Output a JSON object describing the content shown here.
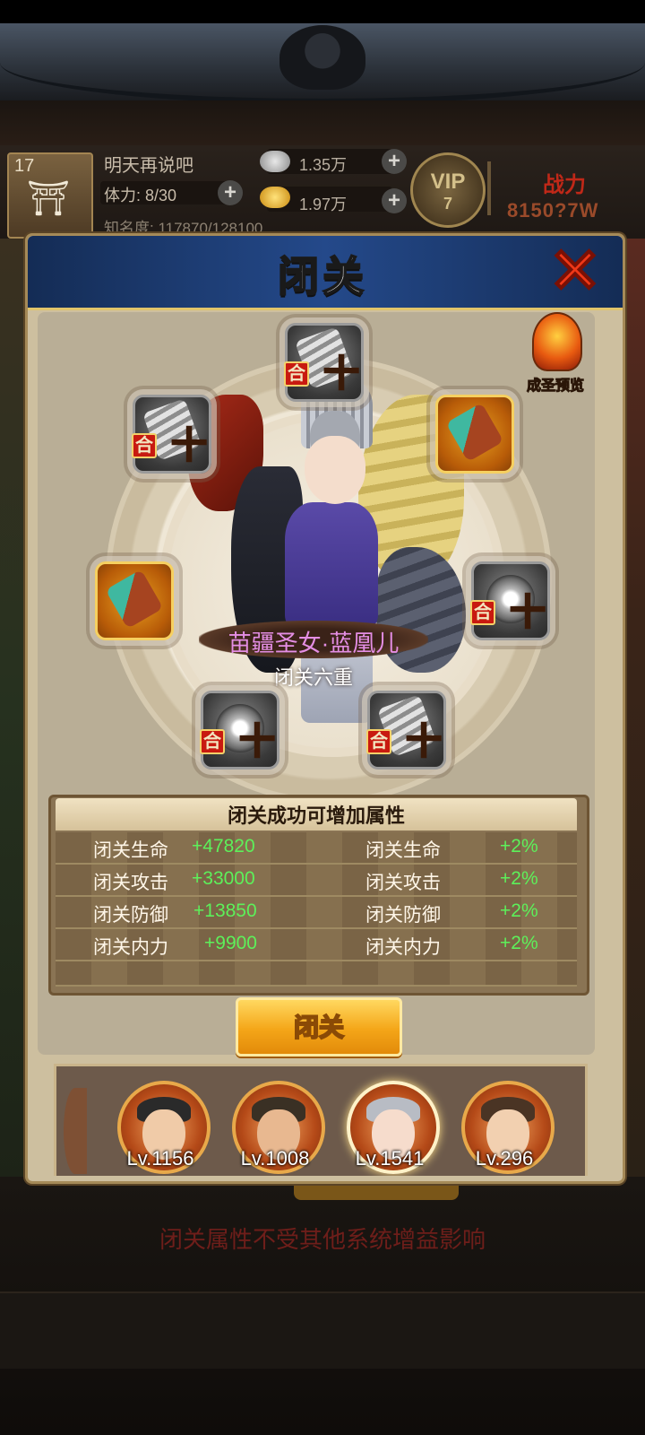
{
  "topbar": {
    "level": "17",
    "player_name": "明天再说吧",
    "stamina_label": "体力: 8/30",
    "fame_label": "知名度: 117870/128100",
    "silver": "1.35万",
    "gold": "1.97万",
    "vip_text": "VIP",
    "vip_level": "7",
    "power_label": "战力",
    "power_value": "8150?7W"
  },
  "panel": {
    "title": "闭关",
    "close_icon": "close-x-icon",
    "preview_label": "成圣预览",
    "hero_name": "苗疆圣女·蓝凰儿",
    "hero_stage": "闭关六重",
    "slots": [
      {
        "he": "合",
        "plus": "十",
        "kind": "silver"
      },
      {
        "he": "合",
        "plus": "十",
        "kind": "silver"
      },
      {
        "he": "",
        "plus": "",
        "kind": "gold"
      },
      {
        "he": "",
        "plus": "",
        "kind": "gold"
      },
      {
        "he": "合",
        "plus": "十",
        "kind": "swirl"
      },
      {
        "he": "合",
        "plus": "十",
        "kind": "swirl"
      },
      {
        "he": "合",
        "plus": "十",
        "kind": "silver"
      }
    ],
    "attr_title": "闭关成功可增加属性",
    "attrs_left": [
      {
        "label": "闭关生命",
        "value": "+47820"
      },
      {
        "label": "闭关攻击",
        "value": "+33000"
      },
      {
        "label": "闭关防御",
        "value": "+13850"
      },
      {
        "label": "闭关内力",
        "value": "+9900"
      }
    ],
    "attrs_right": [
      {
        "label": "闭关生命",
        "value": "+2%"
      },
      {
        "label": "闭关攻击",
        "value": "+2%"
      },
      {
        "label": "闭关防御",
        "value": "+2%"
      },
      {
        "label": "闭关内力",
        "value": "+2%"
      }
    ],
    "button_label": "闭关",
    "heroes": [
      {
        "level": "Lv.1156"
      },
      {
        "level": "Lv.1008"
      },
      {
        "level": "Lv.1541"
      },
      {
        "level": "Lv.296"
      }
    ]
  },
  "footer": {
    "notice": "闭关属性不受其他系统增益影响"
  },
  "colors": {
    "header_blue": "#24498a",
    "bonus_green": "#5df05a",
    "button_orange": "#f4a618",
    "hero_name_pink": "#e48ee4"
  }
}
